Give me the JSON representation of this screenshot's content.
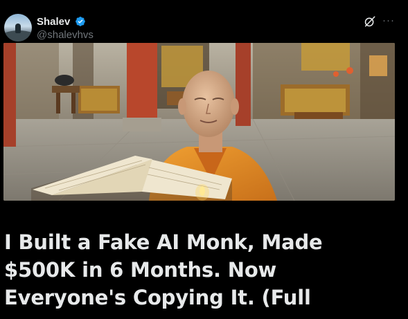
{
  "post": {
    "author_name": "Shalev",
    "author_handle": "@shalevhvs",
    "verified": true,
    "grok_icon": "grok-slash-icon",
    "more_icon": "more-dots-icon",
    "more_label": "···"
  },
  "media": {
    "icon": "photo",
    "colors": {
      "robe": "#e08a1c",
      "pillar": "#b8472c",
      "floor": "#9a948a",
      "gold": "#c49a3a"
    }
  },
  "article": {
    "title_lines": [
      "I Built a Fake AI Monk, Made",
      "$500K in 6 Months. Now",
      "Everyone's Copying It. (Full"
    ]
  },
  "colors": {
    "background": "#000000",
    "text": "#e7e9ea",
    "muted": "#71767b",
    "verified_blue": "#1d9bf0"
  }
}
